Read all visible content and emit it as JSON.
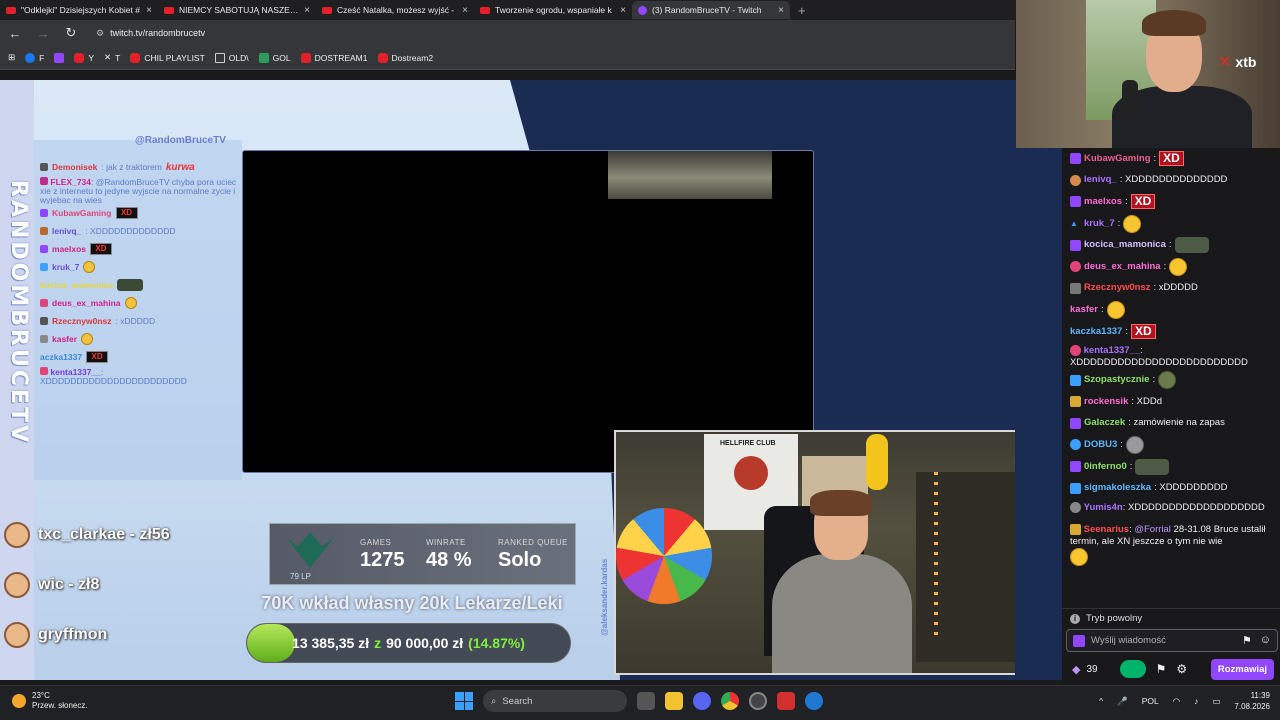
{
  "browser": {
    "tabs": [
      {
        "title": "\"Odklejki\" Dzisiejszych Kobiet #"
      },
      {
        "title": "NIEMCY SABOTUJĄ NASZE ZŁO"
      },
      {
        "title": "Cześć Natalka, możesz wyjść -"
      },
      {
        "title": "Tworzenie ogrodu, wspaniałe k"
      },
      {
        "title": "(3) RandomBruceTV - Twitch"
      }
    ],
    "close_glyph": "×",
    "new_tab_glyph": "+",
    "url": "twitch.tv/randombrucetv",
    "bookmarks": [
      {
        "label": "F",
        "color": "#1877f2"
      },
      {
        "label": "",
        "color": "#9146ff"
      },
      {
        "label": "Y",
        "color": "#e4202a"
      },
      {
        "label": "T",
        "color": "#000000"
      },
      {
        "label": "CHIL PLAYLIST",
        "color": "#e4202a"
      },
      {
        "label": "OLD\\",
        "color": "#888888"
      },
      {
        "label": "GOL",
        "color": "#2a9d5c"
      },
      {
        "label": "DOSTREAM1",
        "color": "#e4202a"
      },
      {
        "label": "Dostream2",
        "color": "#e4202a"
      }
    ]
  },
  "overlay": {
    "vertical_title": "RANDOMBRUCETV",
    "channel_handle": "@RandomBruceTV",
    "chat_lines": [
      {
        "user": "Demonisek",
        "msg": ": jak z traktorem",
        "color": "#d63b3b",
        "icon": "#555",
        "extra": "kurwa"
      },
      {
        "user": "FLEX_734",
        "msg": ": @RandomBruceTV chyba pora uciec xie z internetu to jedyne wyjscie na normalne zycie i wyjebac na wies",
        "color": "#d6208a",
        "icon": "#c22c8c",
        "tall": true
      },
      {
        "user": "KubawGaming",
        "msg": "",
        "color": "#e0457a",
        "icon": "#9146ff",
        "extra": "XD"
      },
      {
        "user": "lenivq_",
        "msg": ": XDDDDDDDDDDDDD",
        "color": "#6a4fd8",
        "icon": "#b86a30"
      },
      {
        "user": "maelxos",
        "msg": "",
        "color": "#d6208a",
        "icon": "#9146ff",
        "extra": "XD"
      },
      {
        "user": "kruk_7",
        "msg": "",
        "color": "#6a4fd8",
        "icon": "#3aa0ff",
        "extra": "smile"
      },
      {
        "user": "kocica_mamonica",
        "msg": "",
        "color": "#e9d43a",
        "icon": "#9146ff",
        "extra": "frog"
      },
      {
        "user": "deus_ex_mahina",
        "msg": "",
        "color": "#d6208a",
        "icon": "#e0457a",
        "extra": "smile"
      },
      {
        "user": "Rzecznyw0nsz",
        "msg": ": xDDDDD",
        "color": "#d63b3b",
        "icon": "#555"
      },
      {
        "user": "kasfer",
        "msg": "",
        "color": "#d6208a",
        "icon": "#888",
        "extra": "smile"
      },
      {
        "user": "aczka1337",
        "msg": "",
        "color": "#3a8ad8",
        "icon": "#3aa0ff",
        "extra": "XD"
      },
      {
        "user": "kenta1337__",
        "msg": ": XDDDDDDDDDDDDDDDDDDDDDDD",
        "color": "#7a3ad8",
        "icon": "#e0457a",
        "tall": true
      }
    ],
    "donors": [
      {
        "name": "txc_clarkae - zł56"
      },
      {
        "name": "wic - zł8"
      },
      {
        "name": "gryffmon"
      }
    ],
    "rank": {
      "lp": "79 LP",
      "games_label": "GAMES",
      "games_value": "1275",
      "winrate_label": "WINRATE",
      "winrate_value": "48 %",
      "queue_label": "RANKED QUEUE",
      "queue_value": "Solo"
    },
    "goal": {
      "title": "70K wkład własny 20k Lekarze/Leki",
      "current": "13 385,35 zł",
      "z": "z",
      "target": "90 000,00 zł",
      "percent_text": "(14.87%)",
      "fraction": 0.1487
    },
    "vertical_handle": "@aleksander.kardas",
    "shirt_text": "HELLFIRE CLUB"
  },
  "sponsor": {
    "name": "xtb",
    "mark": "✕"
  },
  "chat": {
    "messages": [
      {
        "user": "KubawGaming",
        "text": ":",
        "color": "#e8618c",
        "badge": "#9146ff",
        "emote": "XD"
      },
      {
        "user": "lenivq_",
        "text": ": XDDDDDDDDDDDDDD",
        "color": "#a970ff",
        "badge": "#d48a4a"
      },
      {
        "user": "maelxos",
        "text": ":",
        "color": "#ff6bd6",
        "badge": "#9146ff",
        "emote": "XD"
      },
      {
        "user": "kruk_7",
        "text": ":",
        "color": "#a970ff",
        "badge": "#3aa0ff",
        "emote": "smile"
      },
      {
        "user": "kocica_mamonica",
        "text": ":",
        "color": "#d3bfff",
        "badge": "#9146ff",
        "emote": "frog"
      },
      {
        "user": "deus_ex_mahina",
        "text": ":",
        "color": "#ff6bd6",
        "badge": "#e0457a",
        "emote": "smile"
      },
      {
        "user": "Rzecznyw0nsz",
        "text": ": xDDDDD",
        "color": "#ff4d4d",
        "badge": "#777"
      },
      {
        "user": "kasfer",
        "text": ":",
        "color": "#ff6bd6",
        "badge": "",
        "emote": "smile"
      },
      {
        "user": "kaczka1337",
        "text": ":",
        "color": "#5cb8ff",
        "badge": "",
        "emote": "XD"
      },
      {
        "user": "kenta1337__",
        "text": ": XDDDDDDDDDDDDDDDDDDDDDDDDD",
        "color": "#a970ff",
        "badge": "#e0457a",
        "wrap": true
      },
      {
        "user": "Szopastycznie",
        "text": ":",
        "color": "#8ee06a",
        "badge": "#3aa0ff",
        "emote": "frog-small"
      },
      {
        "user": "rockensik",
        "text": ": XDDd",
        "color": "#ff6bd6",
        "badge": "#d8a830"
      },
      {
        "user": "Galaczek",
        "text": ": zamówienie na zapas",
        "color": "#8ee06a",
        "badge": "#9146ff"
      },
      {
        "user": "DOBU3",
        "text": ":",
        "color": "#5cb8ff",
        "badge": "#3aa0ff",
        "emote": "smile-grey"
      },
      {
        "user": "0inferno0",
        "text": ":",
        "color": "#8ee06a",
        "badge": "#9146ff",
        "emote": "frog"
      },
      {
        "user": "sigmakoleszka",
        "text": ": XDDDDDDDDD",
        "color": "#5cb8ff",
        "badge": "#3aa0ff"
      },
      {
        "user": "Yumis4n",
        "text": ": XDDDDDDDDDDDDDDDDDDD",
        "color": "#a970ff",
        "badge": "#888",
        "wrap": true
      },
      {
        "user": "Seenarius",
        "text": " 28-31.08 Bruce ustalił termin, ale XN jeszcze o tym nie wie",
        "mention": "@Forrial",
        "color": "#ff4d4d",
        "badge": "#d8a830",
        "wrap": true,
        "emote": "smile"
      }
    ],
    "slow_mode": "Tryb powolny",
    "info_glyph": "i",
    "input_placeholder": "Wyślij wiadomość",
    "points": "39",
    "send_label": "Rozmawiaj"
  },
  "taskbar": {
    "temperature": "23°C",
    "weather_desc": "Przew. słonecz.",
    "search_placeholder": "Search",
    "language": "POL",
    "time": "11:39",
    "date": "7.08.2026"
  },
  "icons": {
    "back": "←",
    "forward": "→",
    "reload": "↻",
    "apps": "⊞",
    "tune": "⚙",
    "search": "⌕",
    "emote_picker": "☺",
    "bits": "⚑",
    "settings": "⚙",
    "chevron_up": "^",
    "mic": "🎤",
    "wifi": "◠",
    "speaker": "♪",
    "battery": "▭",
    "channel_points": "◆"
  }
}
